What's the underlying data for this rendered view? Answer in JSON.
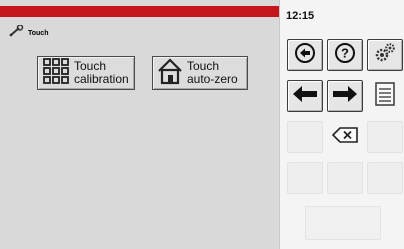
{
  "header": {
    "icon": "wrench-icon",
    "title": "Touch"
  },
  "status": {
    "time": "12:15",
    "accent_color": "#c4161c"
  },
  "menu_buttons": [
    {
      "icon": "grid-icon",
      "label_line1": "Touch",
      "label_line2": "calibration"
    },
    {
      "icon": "home-icon",
      "label_line1": "Touch",
      "label_line2": "auto-zero"
    }
  ],
  "keypad": {
    "back": "back-circle-icon",
    "help": "help-icon",
    "settings": "gears-icon",
    "left": "arrow-left-icon",
    "right": "arrow-right-icon",
    "save": "save-icon",
    "delete": "backspace-icon"
  }
}
